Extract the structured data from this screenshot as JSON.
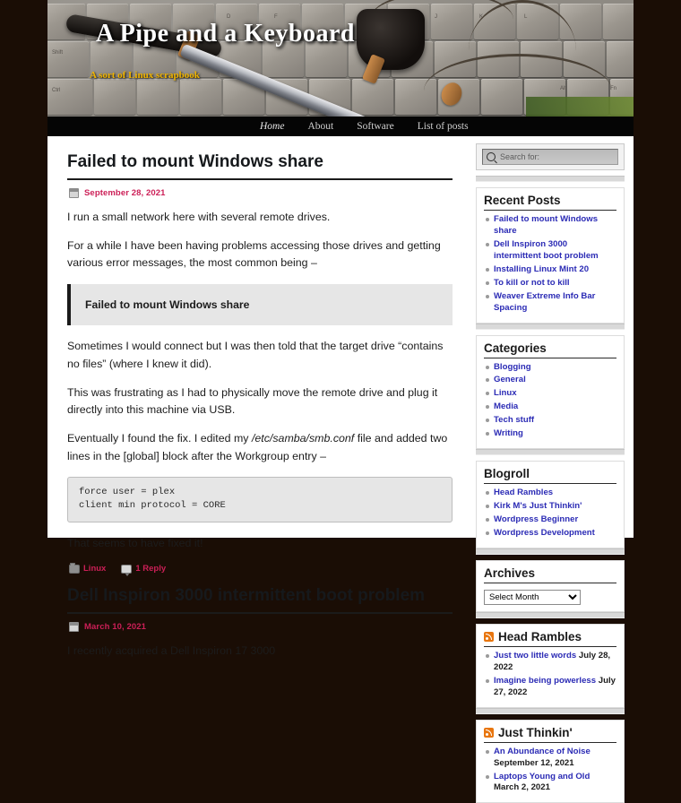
{
  "site": {
    "title": "A Pipe and a Keyboard",
    "tagline": "A sort of Linux scrapbook"
  },
  "nav": {
    "items": [
      {
        "label": "Home",
        "current": true
      },
      {
        "label": "About",
        "current": false
      },
      {
        "label": "Software",
        "current": false
      },
      {
        "label": "List of posts",
        "current": false
      }
    ]
  },
  "posts": [
    {
      "title": "Failed to mount Windows share",
      "date": "September 28, 2021",
      "paragraphs": [
        "I run a small network here with several remote drives.",
        "For a while I have been having problems accessing those drives and getting various error messages, the most common being –"
      ],
      "quote": "Failed to mount Windows share",
      "paragraphs2": [
        "Sometimes I would connect but I was then told that the target drive “contains no files” (where I knew it did).",
        "This was frustrating as I had to physically move the remote drive and plug it directly into this machine via USB."
      ],
      "para_fix_pre": "Eventually I found the fix. I edited my ",
      "para_fix_em": "/etc/samba/smb.conf",
      "para_fix_post": " file and added two lines in the [global] block after the Workgroup entry –",
      "code": "force user = plex\nclient min protocol = CORE",
      "closing": "That seems to have fixed it!",
      "category": "Linux",
      "replies": "1 Reply"
    },
    {
      "title": "Dell Inspiron 3000 intermittent boot problem",
      "date": "March 10, 2021",
      "first_line": "I recently acquired a Dell Inspiron 17 3000"
    }
  ],
  "sidebar": {
    "search": {
      "placeholder": "Search for:",
      "value": ""
    },
    "recent_posts": {
      "title": "Recent Posts",
      "items": [
        "Failed to mount Windows share",
        "Dell Inspiron 3000 intermittent boot problem",
        "Installing Linux Mint 20",
        "To kill or not to kill",
        "Weaver Extreme Info Bar Spacing"
      ]
    },
    "categories": {
      "title": "Categories",
      "items": [
        "Blogging",
        "General",
        "Linux",
        "Media",
        "Tech stuff",
        "Writing"
      ]
    },
    "blogroll": {
      "title": "Blogroll",
      "items": [
        "Head Rambles",
        "Kirk M's Just Thinkin'",
        "Wordpress Beginner",
        "Wordpress Development"
      ]
    },
    "archives": {
      "title": "Archives",
      "selected": "Select Month"
    },
    "feeds": [
      {
        "title": "Head Rambles",
        "items": [
          {
            "link": "Just two little words",
            "date": " July 28, 2022"
          },
          {
            "link": "Imagine being powerless",
            "date": " July 27, 2022"
          }
        ]
      },
      {
        "title": "Just Thinkin'",
        "items": [
          {
            "link": "An Abundance of Noise",
            "date": " September 12, 2021"
          },
          {
            "link": "Laptops Young and Old",
            "date": " March 2, 2021"
          }
        ]
      }
    ]
  },
  "colors": {
    "page_bg": "#1a0d05",
    "nav_bg": "#050505",
    "meta_pink": "#cc1f57",
    "link_blue": "#2b2bb5",
    "rss_orange": "#e8760f",
    "tagline_gold": "#f0b400"
  }
}
